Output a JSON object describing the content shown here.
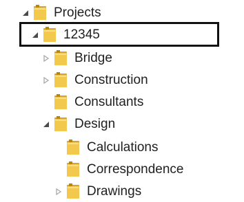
{
  "tree": {
    "items": [
      {
        "label": "Projects",
        "state": "expanded",
        "depth": 0
      },
      {
        "label": "12345",
        "state": "expanded",
        "depth": 1,
        "selected": true
      },
      {
        "label": "Bridge",
        "state": "collapsed",
        "depth": 2
      },
      {
        "label": "Construction",
        "state": "collapsed",
        "depth": 2
      },
      {
        "label": "Consultants",
        "state": "leaf",
        "depth": 2
      },
      {
        "label": "Design",
        "state": "expanded",
        "depth": 2
      },
      {
        "label": "Calculations",
        "state": "leaf",
        "depth": 3
      },
      {
        "label": "Correspondence",
        "state": "leaf",
        "depth": 3
      },
      {
        "label": "Drawings",
        "state": "collapsed",
        "depth": 3
      }
    ],
    "icons": {
      "expanded": "expanded-arrow-icon",
      "collapsed": "collapsed-arrow-icon",
      "folder": "folder-icon"
    },
    "colors": {
      "folder_front": "#f2c94c",
      "folder_back": "#d4a72c",
      "folder_dark": "#b8860b",
      "arrow_expanded": "#4a4a4a",
      "arrow_collapsed": "#a9a9a9",
      "selection_border": "#111111"
    }
  }
}
